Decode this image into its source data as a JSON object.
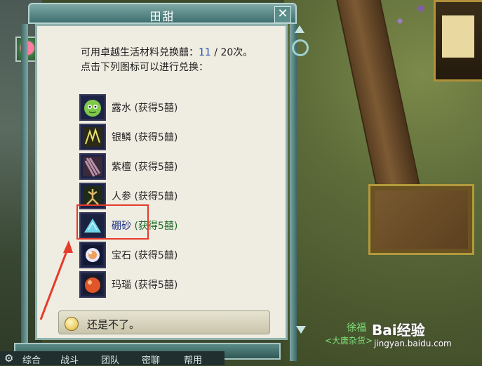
{
  "window": {
    "title": "田甜",
    "close_label": "✕"
  },
  "intro": {
    "line1_prefix": "可用卓越生活材料兑换囍：",
    "used": "11",
    "sep": " / ",
    "total": "20次。",
    "line2": "点击下列图标可以进行兑换："
  },
  "items": [
    {
      "name": "露水",
      "reward": " (获得5囍)",
      "icon": "dew-icon"
    },
    {
      "name": "银鳞",
      "reward": " (获得5囍)",
      "icon": "silver-scale-icon"
    },
    {
      "name": "紫檀",
      "reward": " (获得5囍)",
      "icon": "rosewood-icon"
    },
    {
      "name": "人参",
      "reward": " (获得5囍)",
      "icon": "ginseng-icon"
    },
    {
      "name": "硼砂",
      "reward": " (获得5囍)",
      "icon": "borax-icon"
    },
    {
      "name": "宝石",
      "reward": " (获得5囍)",
      "icon": "gem-icon"
    },
    {
      "name": "玛瑙",
      "reward": " (获得5囍)",
      "icon": "agate-icon"
    }
  ],
  "option": {
    "label": "还是不了。"
  },
  "tabs": [
    "综合",
    "战斗",
    "团队",
    "密聊",
    "帮用"
  ],
  "npc": {
    "name": "徐福",
    "shop": "<大唐杂货>"
  },
  "watermark": {
    "brand": "Bai经验",
    "url": "jingyan.baidu.com"
  },
  "colors": {
    "highlight": "#e53b2b",
    "accent": "#3e6f6f"
  }
}
